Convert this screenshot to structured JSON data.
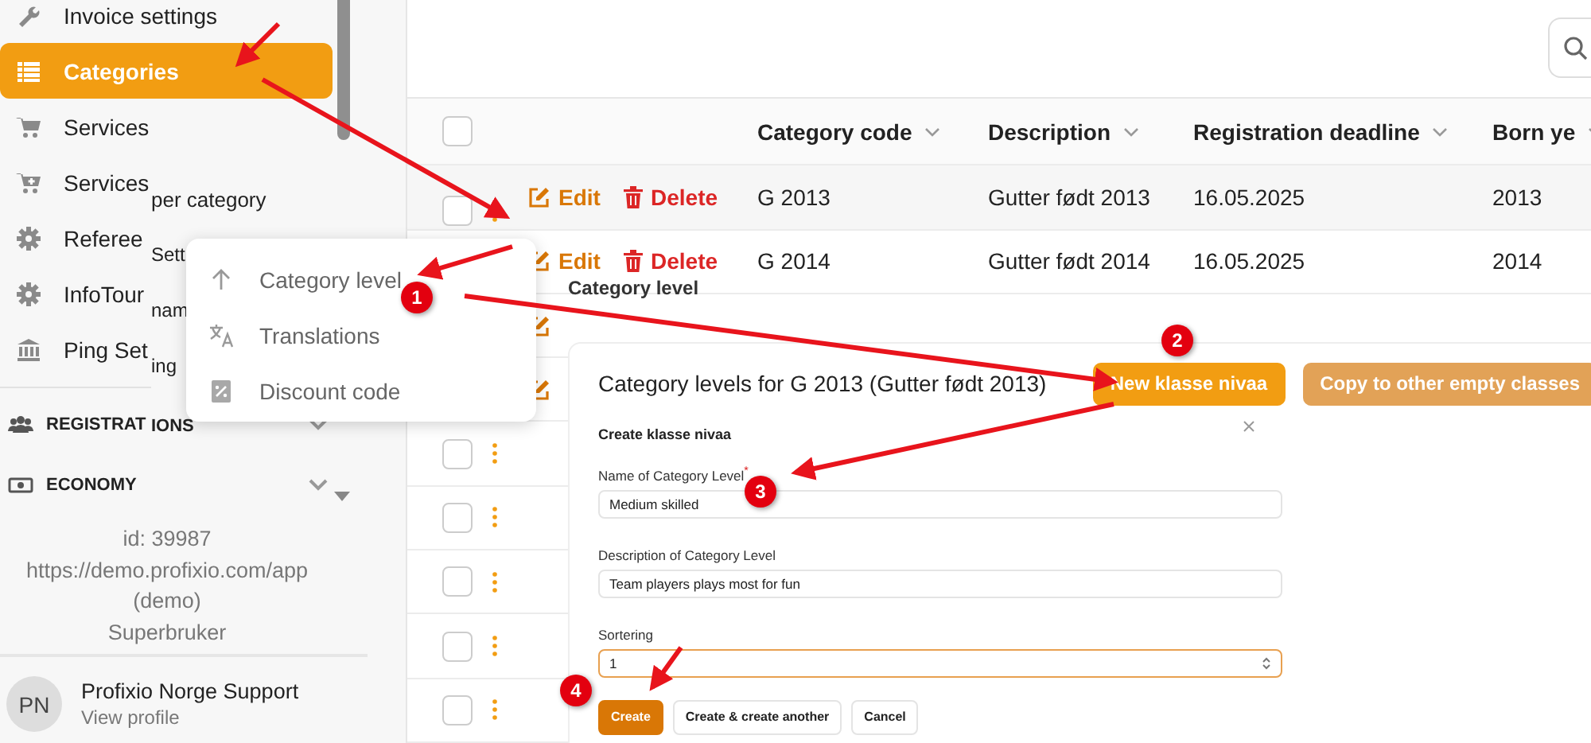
{
  "sidebar": {
    "items": [
      {
        "label": "Invoice settings",
        "selected": false
      },
      {
        "label": "Categories",
        "selected": true
      },
      {
        "label": "Services",
        "selected": false
      },
      {
        "label": "Services",
        "selected": false
      },
      {
        "label": "Referee",
        "selected": false
      },
      {
        "label": "InfoTour",
        "selected": false
      },
      {
        "label": "Ping Set",
        "selected": false
      }
    ],
    "fragments": [
      "per category",
      "Sett",
      "nam",
      "ing",
      "IONS"
    ],
    "sections": [
      {
        "label": "REGISTRAT"
      },
      {
        "label": "ECONOMY"
      }
    ],
    "info": [
      "id: 39987",
      "https://demo.profixio.com/app",
      "(demo)",
      "Superbruker"
    ],
    "user": {
      "initials": "PN",
      "name": "Profixio Norge Support",
      "link": "View profile"
    }
  },
  "table": {
    "columns": [
      "Category code",
      "Description",
      "Registration deadline",
      "Born ye"
    ],
    "header_checked": false,
    "rows": [
      {
        "kind": "full",
        "checked": false,
        "actions": [
          "Edit",
          "Delete"
        ],
        "cells": [
          "G 2013",
          "Gutter født 2013",
          "16.05.2025",
          "2013"
        ]
      },
      {
        "kind": "no-select",
        "actions": [
          "Edit",
          "Delete"
        ],
        "cells": [
          "G 2014",
          "Gutter født 2014",
          "16.05.2025",
          "2014"
        ]
      },
      {
        "kind": "edit-icon"
      },
      {
        "kind": "edit-icon"
      },
      {
        "kind": "select",
        "checked": false
      },
      {
        "kind": "select",
        "checked": false
      },
      {
        "kind": "select",
        "checked": false
      },
      {
        "kind": "select",
        "checked": false
      },
      {
        "kind": "select",
        "checked": false
      }
    ]
  },
  "row_menu": {
    "items": [
      {
        "label": "Category level"
      },
      {
        "label": "Translations"
      },
      {
        "label": "Discount code"
      }
    ]
  },
  "dialog": {
    "heading": "Category level",
    "title": "Category levels for G 2013 (Gutter født 2013)",
    "buttons": [
      {
        "label": "New klasse nivaa",
        "kind": "primary"
      },
      {
        "label": "Copy to other empty classes",
        "kind": "secondary"
      }
    ],
    "form": {
      "title": "Create klasse nivaa",
      "fields": [
        {
          "label": "Name of Category Level",
          "required_mark": "*",
          "value": "Medium skilled",
          "focused": false,
          "kind": "text"
        },
        {
          "label": "Description of Category Level",
          "value": "Team players plays most for fun",
          "focused": false,
          "kind": "text"
        },
        {
          "label": "Sortering",
          "value": "1",
          "focused": true,
          "kind": "number"
        }
      ],
      "buttons": [
        {
          "label": "Create",
          "kind": "primary"
        },
        {
          "label": "Create & create another",
          "kind": "plain"
        },
        {
          "label": "Cancel",
          "kind": "plain"
        }
      ]
    }
  },
  "annotations": {
    "steps": [
      "1",
      "2",
      "3",
      "4"
    ]
  }
}
